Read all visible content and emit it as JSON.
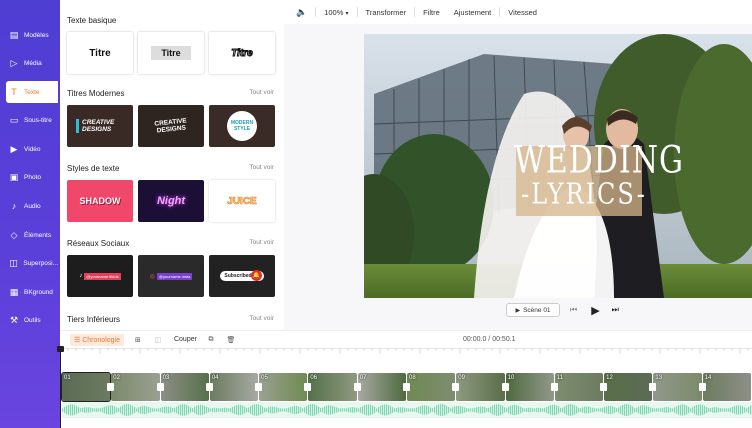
{
  "sidebar": {
    "items": [
      {
        "label": "Modèles",
        "icon": "template-icon"
      },
      {
        "label": "Média",
        "icon": "media-icon"
      },
      {
        "label": "Texte",
        "icon": "text-icon",
        "active": true
      },
      {
        "label": "Sous-titre",
        "icon": "subtitle-icon"
      },
      {
        "label": "Vidéo",
        "icon": "video-icon"
      },
      {
        "label": "Photo",
        "icon": "photo-icon"
      },
      {
        "label": "Audio",
        "icon": "audio-icon"
      },
      {
        "label": "Éléments",
        "icon": "elements-icon"
      },
      {
        "label": "Superposi...",
        "icon": "overlay-icon"
      },
      {
        "label": "BKground",
        "icon": "background-icon"
      },
      {
        "label": "Outils",
        "icon": "tools-icon"
      }
    ]
  },
  "panel": {
    "see_all": "Tout voir",
    "sections": {
      "basic": {
        "title": "Texte basique",
        "cards": [
          "Titre",
          "Titre",
          "Titre"
        ]
      },
      "modern": {
        "title": "Titres Modernes",
        "cards": [
          "CREATIVE DESIGNS",
          "CREATIVE DESIGNS",
          "MODERN STYLE"
        ]
      },
      "styles": {
        "title": "Styles de texte",
        "cards": [
          "SHADOW",
          "Night",
          "JUICE"
        ]
      },
      "social": {
        "title": "Réseaux Sociaux",
        "cards": [
          "@yourname.tiktok",
          "@yourname.insta",
          "Subscribed"
        ]
      },
      "lower": {
        "title": "Tiers Inférieurs"
      }
    }
  },
  "toolbar": {
    "zoom": "100%",
    "transform": "Transformer",
    "filter": "Filtre",
    "adjust": "Ajustement",
    "speed": "Vitessed"
  },
  "preview": {
    "title_line1": "WEDDING",
    "title_line2": "-LYRICS-",
    "scene_label": "Scène 01"
  },
  "timeline": {
    "chrono_label": "Chronologie",
    "cut_label": "Couper",
    "time": "00:00.0 / 00:50.1",
    "clips": [
      "01",
      "02",
      "03",
      "04",
      "05",
      "06",
      "07",
      "08",
      "09",
      "10",
      "11",
      "12",
      "13",
      "14"
    ]
  },
  "colors": {
    "sidebar": "#5b3fd9",
    "accent": "#f07b2c",
    "audio_wave": "#7fd8b4"
  }
}
